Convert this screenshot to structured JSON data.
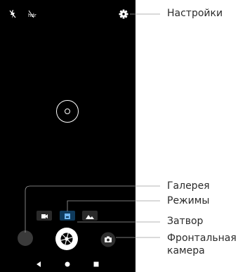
{
  "labels": {
    "settings": "Настройки",
    "gallery": "Галерея",
    "modes": "Режимы",
    "shutter": "Затвор",
    "front_camera": "Фронтальная камера"
  },
  "status_icons": [
    "flash-off-icon",
    "hdr-off-icon"
  ],
  "modes": [
    {
      "name": "video-mode-icon",
      "active": false
    },
    {
      "name": "photo-mode-icon",
      "active": true
    },
    {
      "name": "panorama-mode-icon",
      "active": false
    }
  ],
  "nav_icons": [
    "back-icon",
    "home-icon",
    "recents-icon"
  ],
  "colors": {
    "viewfinder": "#000000",
    "active_mode": "#0f3a5c",
    "active_mode_icon": "#6fb6f0",
    "callout_text": "#2b2b2b",
    "callout_line": "#9e9e9e"
  }
}
